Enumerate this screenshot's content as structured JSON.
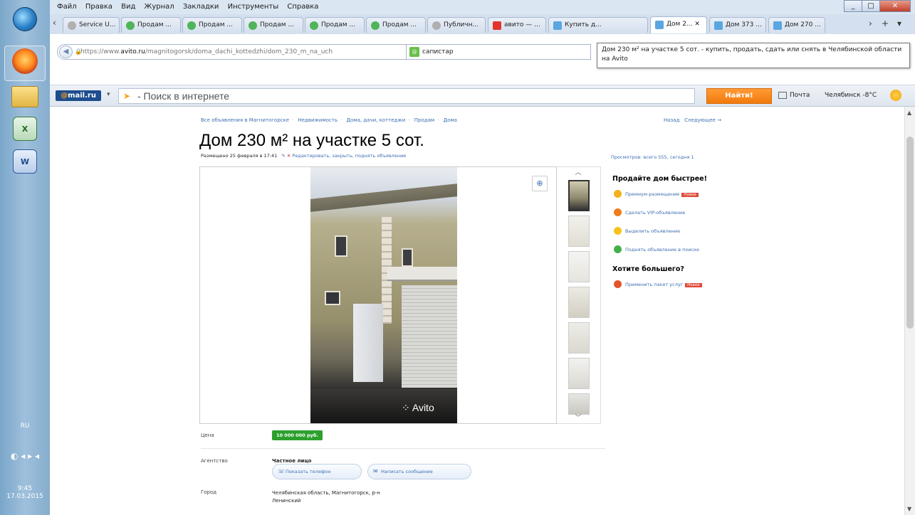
{
  "taskbar": {
    "lang": "RU",
    "time": "9:45",
    "date": "17.03.2015"
  },
  "browser": {
    "menu": [
      "Файл",
      "Правка",
      "Вид",
      "Журнал",
      "Закладки",
      "Инструменты",
      "Справка"
    ],
    "tabs": [
      {
        "label": "Service U...",
        "type": "grey"
      },
      {
        "label": "Продам ...",
        "type": "green"
      },
      {
        "label": "Продам ...",
        "type": "green"
      },
      {
        "label": "Продам ...",
        "type": "green"
      },
      {
        "label": "Продам ...",
        "type": "green"
      },
      {
        "label": "Продам ...",
        "type": "green"
      },
      {
        "label": "Публичн...",
        "type": "grey"
      },
      {
        "label": "авито — ...",
        "type": "red"
      },
      {
        "label": "Купить д...",
        "type": "avito"
      },
      {
        "label": "Дом 2...",
        "type": "avito",
        "active": true
      },
      {
        "label": "Дом 373 ...",
        "type": "avito"
      },
      {
        "label": "Дом 270 ...",
        "type": "avito"
      }
    ],
    "url_prefix": "https://www.",
    "url_domain": "avito.ru",
    "url_path": "/magnitogorsk/doma_dachi_kottedzhi/dom_230_m_na_uch",
    "search_engine_label": "сапистар",
    "tooltip": "Дом 230 м² на участке 5 сот. - купить, продать, сдать или снять в Челябинской области на Avito"
  },
  "mailbar": {
    "logo_at": "@",
    "logo_text": "mail.ru",
    "search_placeholder": "- Поиск в интернете",
    "find_label": "Найти!",
    "mail_label": "Почта",
    "weather": "Челябинск -8°C"
  },
  "page": {
    "breadcrumbs": [
      "Все объявления в Магнитогорске",
      "Недвижимость",
      "Дома, дачи, коттеджи",
      "Продам",
      "Дома"
    ],
    "nav_back": "Назад",
    "nav_next": "Следующее →",
    "title": "Дом 230 м² на участке 5 сот.",
    "placed": "Размещено 25 февраля в 17:41",
    "edit_links": "Редактировать, закрыть, поднять объявление",
    "views": "Просмотров: всего 555, сегодня 1",
    "watermark": "Avito",
    "promo": {
      "title1": "Продайте дом быстрее!",
      "items": [
        {
          "label": "Премиум-размещение",
          "badge": "Новое",
          "color": "#f2b21b"
        },
        {
          "label": "Сделать VIP-объявление",
          "badge": "",
          "color": "#f07d1a"
        },
        {
          "label": "Выделить объявление",
          "badge": "",
          "color": "#f7c21e"
        },
        {
          "label": "Поднять объявление в поиске",
          "badge": "",
          "color": "#44b04a"
        }
      ],
      "title2": "Хотите большего?",
      "package": {
        "label": "Применить пакет услуг",
        "badge": "Новое"
      }
    },
    "price_label": "Цена",
    "price_value": "10 000 000 руб.",
    "agency_label": "Агентство",
    "agency_value": "Частное лицо",
    "phone_button": "Показать телефон",
    "message_button": "Написать сообщение",
    "city_label": "Город",
    "city_value_line1": "Челябинская область, Магнитогорск, р-н",
    "city_value_line2": "Ленинский"
  }
}
